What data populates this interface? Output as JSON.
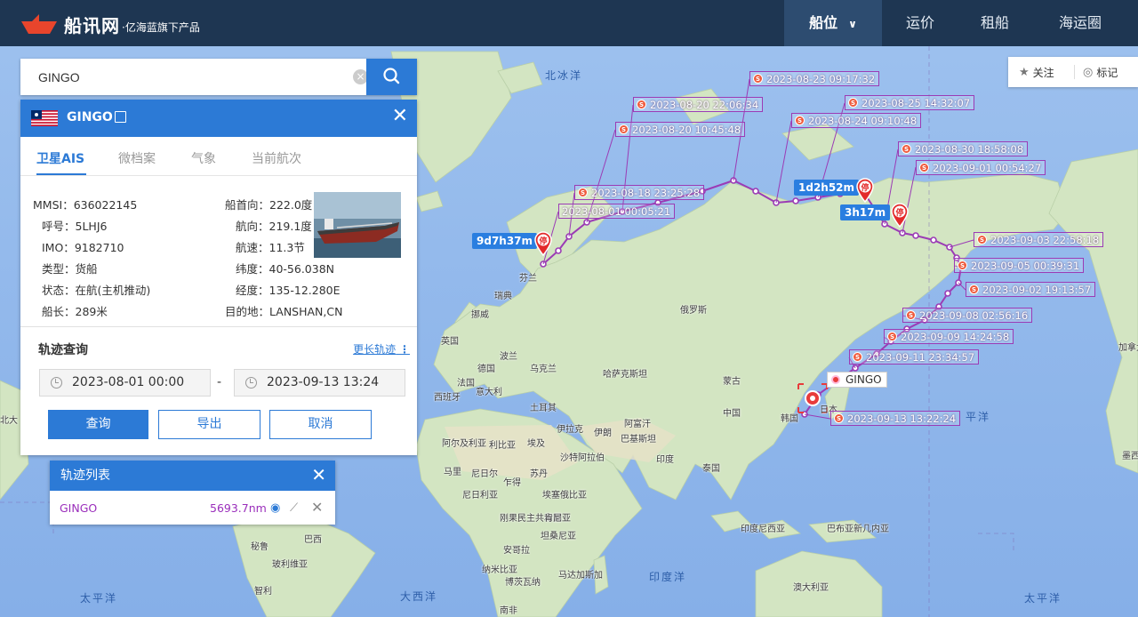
{
  "nav": {
    "logo_name": "船讯网",
    "logo_sub": "·亿海蓝旗下产品",
    "items": [
      "船位",
      "运价",
      "租船",
      "海运圈"
    ],
    "active_index": 0
  },
  "search": {
    "value": "GINGO",
    "clear_icon": "clear-circle-icon",
    "button_icon": "search-icon"
  },
  "vessel": {
    "flag": "Liberia",
    "name": "GINGO",
    "tabs": [
      "卫星AIS",
      "微档案",
      "气象",
      "当前航次"
    ],
    "active_tab": 0,
    "left": [
      {
        "k": "MMSI：",
        "v": "636022145"
      },
      {
        "k": "呼号：",
        "v": "5LHJ6"
      },
      {
        "k": "IMO：",
        "v": "9182710"
      },
      {
        "k": "类型：",
        "v": "货船"
      },
      {
        "k": "状态：",
        "v": "在航(主机推动)"
      },
      {
        "k": "船长：",
        "v": "289米"
      }
    ],
    "right": [
      {
        "k": "船首向：",
        "v": "222.0度"
      },
      {
        "k": "航向：",
        "v": "219.1度"
      },
      {
        "k": "航速：",
        "v": "11.3节"
      },
      {
        "k": "纬度：",
        "v": "40-56.038N"
      },
      {
        "k": "经度：",
        "v": "135-12.280E"
      },
      {
        "k": "目的地：",
        "v": "LANSHAN,CN"
      }
    ]
  },
  "track_query": {
    "title": "轨迹查询",
    "more_link": "更长轨迹",
    "start": "2023-08-01 00:00",
    "end": "2023-09-13 13:24",
    "separator": "-",
    "buttons": {
      "query": "查询",
      "export": "导出",
      "cancel": "取消"
    }
  },
  "track_list": {
    "title": "轨迹列表",
    "rows": [
      {
        "name": "GINGO",
        "distance": "5693.7nm"
      }
    ]
  },
  "tools": {
    "follow": "关注",
    "mark": "标记"
  },
  "map": {
    "oceans": [
      "北冰洋",
      "太平洋",
      "大西洋",
      "印度洋",
      "太平洋",
      "平洋"
    ],
    "places": [
      "芬兰",
      "瑞典",
      "挪威",
      "英国",
      "法国",
      "德国",
      "波兰",
      "乌克兰",
      "西班牙",
      "意大利",
      "土耳其",
      "俄罗斯",
      "哈萨克斯坦",
      "蒙古",
      "中国",
      "伊拉克",
      "伊朗",
      "阿富汗",
      "巴基斯坦",
      "印度",
      "泰国",
      "韩国",
      "日本",
      "阿尔及利亚",
      "利比亚",
      "埃及",
      "沙特阿拉伯",
      "马里",
      "尼日尔",
      "苏丹",
      "乍得",
      "尼日利亚",
      "埃塞俄比亚",
      "刚果民主共和国",
      "肯尼亚",
      "坦桑尼亚",
      "安哥拉",
      "纳米比亚",
      "博茨瓦纳",
      "马达加斯加",
      "印度尼西亚",
      "巴布亚新几内亚",
      "澳大利亚",
      "秘鲁",
      "巴西",
      "玻利维亚",
      "智利",
      "南非",
      "加拿大",
      "墨西",
      "北大"
    ],
    "ship_label": "GINGO",
    "stops": [
      "9d7h37m",
      "1d2h52m",
      "3h17m"
    ],
    "stop_pin_text": "停",
    "track_color": "#9b3bb5",
    "track_times": [
      "2023-08-23 09:17:32",
      "2023-08-20 22:06:34",
      "2023-08-25 14:32:07",
      "2023-08-20 10:45:48",
      "2023-08-24 09:10:48",
      "2023-08-30 18:58:08",
      "2023-09-01 00:54:27",
      "2023-08-18 23:25:28",
      "2023-08-01 00:05:21",
      "2023-09-03 22:58:18",
      "2023-09-05 00:39:31",
      "2023-09-02 19:13:57",
      "2023-09-08 02:56:16",
      "2023-09-09 14:24:58",
      "2023-09-11 23:34:57",
      "2023-09-13 13:22:24"
    ]
  }
}
